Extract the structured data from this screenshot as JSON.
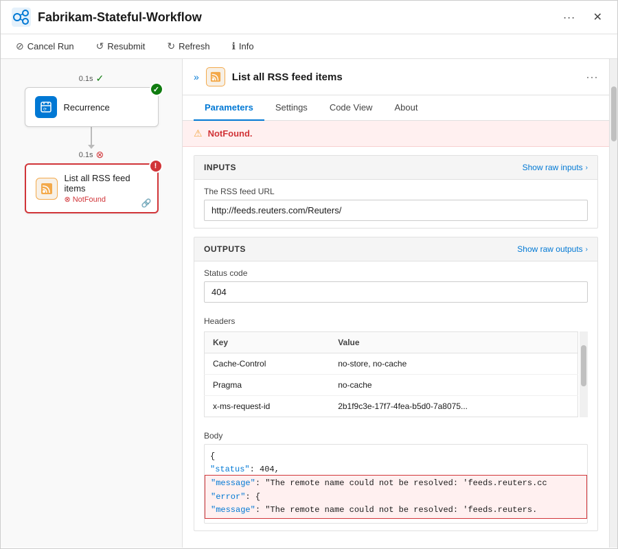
{
  "titleBar": {
    "icon": "🔗",
    "title": "Fabrikam-Stateful-Workflow",
    "ellipsis": "···",
    "close": "✕"
  },
  "toolbar": {
    "cancelRun": "Cancel Run",
    "resubmit": "Resubmit",
    "refresh": "Refresh",
    "info": "Info"
  },
  "canvas": {
    "recurrence": {
      "time": "0.1s",
      "label": "Recurrence",
      "status": "success"
    },
    "listRSSFeedItems": {
      "time": "0.1s",
      "label": "List all RSS feed items",
      "sublabel": "NotFound",
      "status": "error"
    }
  },
  "detailPanel": {
    "expandIcon": "»",
    "title": "List all RSS feed items",
    "ellipsis": "···",
    "tabs": [
      "Parameters",
      "Settings",
      "Code View",
      "About"
    ],
    "activeTab": "Parameters",
    "errorBanner": "NotFound.",
    "inputs": {
      "sectionTitle": "INPUTS",
      "showRawInputs": "Show raw inputs",
      "rssUrlLabel": "The RSS feed URL",
      "rssUrlValue": "http://feeds.reuters.com/Reuters/"
    },
    "outputs": {
      "sectionTitle": "OUTPUTS",
      "showRawOutputs": "Show raw outputs",
      "statusCodeLabel": "Status code",
      "statusCodeValue": "404",
      "headersLabel": "Headers",
      "headersColumns": [
        "Key",
        "Value"
      ],
      "headersRows": [
        {
          "key": "Cache-Control",
          "value": "no-store, no-cache"
        },
        {
          "key": "Pragma",
          "value": "no-cache"
        },
        {
          "key": "x-ms-request-id",
          "value": "2b1f9c3e-17f7-4fea-b5d0-7a8075..."
        }
      ],
      "bodyLabel": "Body",
      "bodyLines": [
        {
          "text": "{",
          "highlighted": false
        },
        {
          "text": "    \"status\": 404,",
          "highlighted": false
        },
        {
          "text": "    \"message\": \"The remote name could not be resolved: 'feeds.reuters.cc",
          "highlighted": true
        },
        {
          "text": "    \"error\": {",
          "highlighted": true
        },
        {
          "text": "        \"message\": \"The remote name could not be resolved: 'feeds.reuters.",
          "highlighted": true
        }
      ]
    }
  }
}
